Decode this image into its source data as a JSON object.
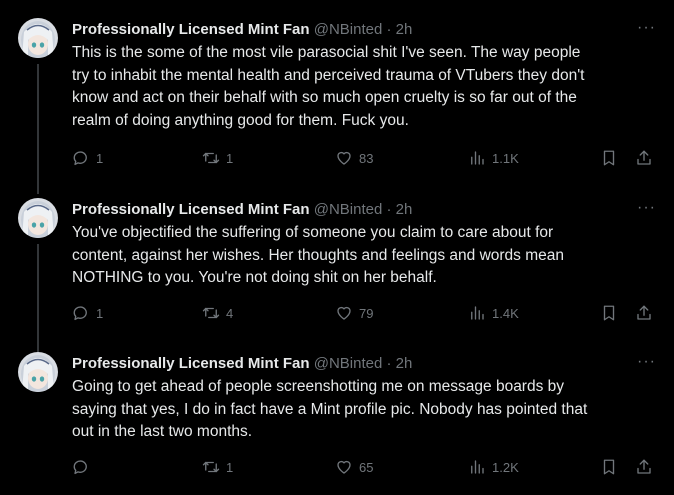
{
  "tweets": [
    {
      "name": "Professionally Licensed Mint Fan",
      "handle": "@NBinted",
      "sep": "·",
      "time": "2h",
      "more": "···",
      "lines": [
        "This is the some of the most vile parasocial shit I've seen. The way people",
        "try to inhabit the mental health and perceived trauma of VTubers they don't",
        "know and act on their behalf with so much open cruelty is so far out of the",
        "realm of doing anything good for them. Fuck you."
      ],
      "replies": "1",
      "reposts": "1",
      "likes": "83",
      "views": "1.1K"
    },
    {
      "name": "Professionally Licensed Mint Fan",
      "handle": "@NBinted",
      "sep": "·",
      "time": "2h",
      "more": "···",
      "lines": [
        "You've objectified the suffering of someone you claim to care about for",
        "content, against her wishes. Her thoughts and feelings and words mean",
        "NOTHING to you. You're not doing shit on her behalf."
      ],
      "replies": "1",
      "reposts": "4",
      "likes": "79",
      "views": "1.4K"
    },
    {
      "name": "Professionally Licensed Mint Fan",
      "handle": "@NBinted",
      "sep": "·",
      "time": "2h",
      "more": "···",
      "lines": [
        "Going to get ahead of people screenshotting me on message boards by",
        "saying that yes, I do in fact have a Mint profile pic. Nobody has pointed that",
        "out in the last two months."
      ],
      "replies": "",
      "reposts": "1",
      "likes": "65",
      "views": "1.2K"
    }
  ],
  "icons": {
    "reply": "reply-icon",
    "repost": "repost-icon",
    "like": "heart-icon",
    "views": "views-icon",
    "bookmark": "bookmark-icon",
    "share": "share-icon"
  },
  "colors": {
    "background": "#000000",
    "text": "#e7e9ea",
    "muted": "#71767b",
    "thread_line": "#333639"
  }
}
